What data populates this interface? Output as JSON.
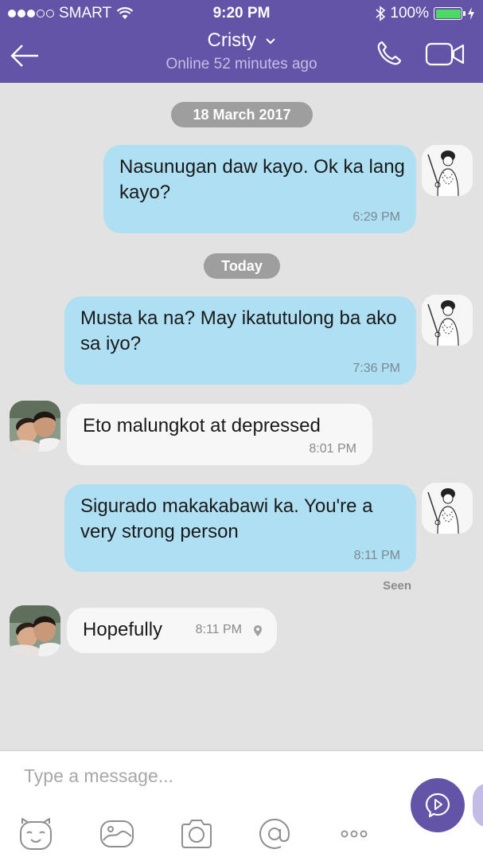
{
  "status_bar": {
    "carrier": "SMART",
    "time": "9:20 PM",
    "battery": "100%"
  },
  "header": {
    "contact_name": "Cristy",
    "presence": "Online 52 minutes ago"
  },
  "dates": {
    "first": "18 March 2017",
    "second": "Today"
  },
  "messages": [
    {
      "direction": "out",
      "text": "Nasunugan daw kayo. Ok ka lang kayo?",
      "time": "6:29 PM"
    },
    {
      "direction": "out",
      "text": "Musta ka na? May ikatutulong ba ako sa iyo?",
      "time": "7:36 PM"
    },
    {
      "direction": "in",
      "text": "Eto malungkot at depressed",
      "time": "8:01 PM"
    },
    {
      "direction": "out",
      "text": "Sigurado makakabawi ka. You're a very strong person",
      "time": "8:11 PM"
    },
    {
      "direction": "in",
      "text": "Hopefully",
      "time": "8:11 PM"
    }
  ],
  "seen_label": "Seen",
  "composer": {
    "placeholder": "Type a message..."
  },
  "colors": {
    "header": "#6354a8",
    "outgoing_bubble": "#aedff3",
    "incoming_bubble": "#f7f7f7",
    "background": "#e2e2e2"
  },
  "icons": [
    "back-arrow-icon",
    "chevron-down-icon",
    "phone-icon",
    "video-camera-icon",
    "location-pin-icon",
    "sticker-icon",
    "image-icon",
    "camera-icon",
    "at-mention-icon",
    "more-icon",
    "send-icon"
  ]
}
